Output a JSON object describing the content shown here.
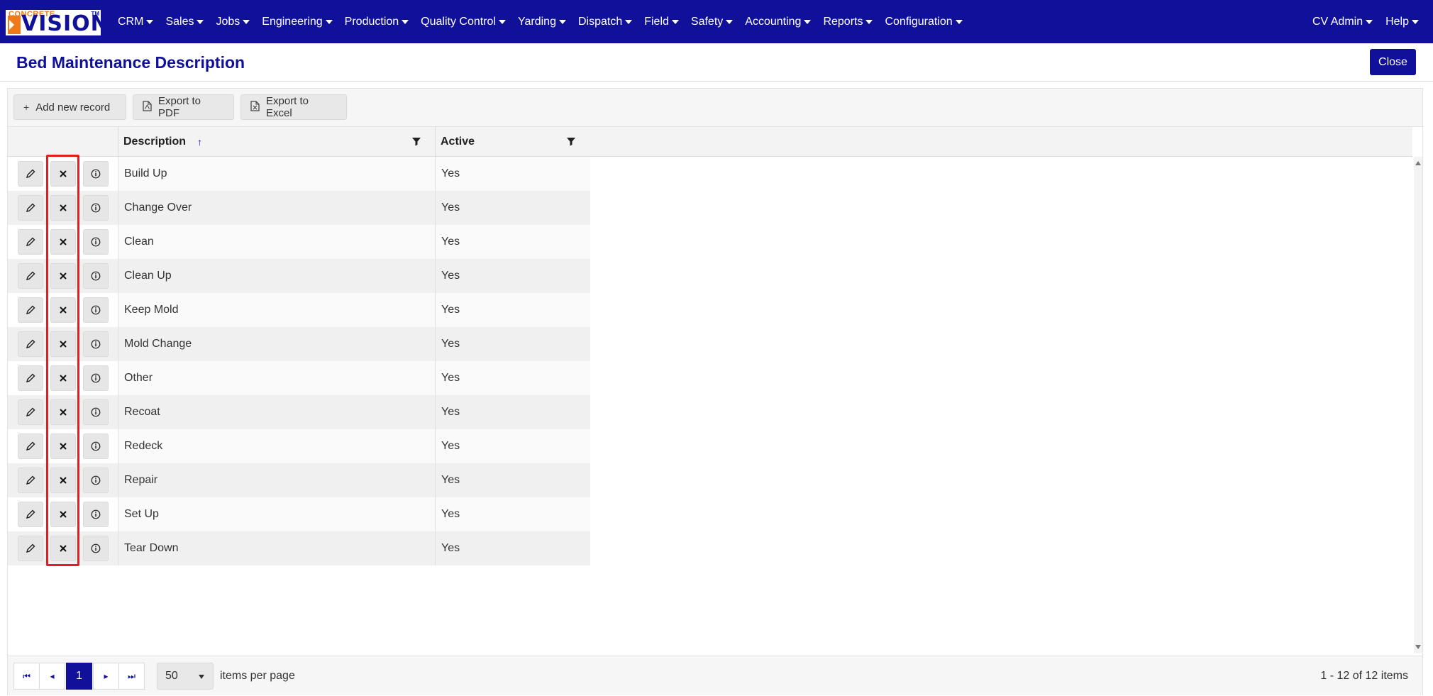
{
  "app": {
    "logo": {
      "top_text": "CONCRETE",
      "main_text": "VISION",
      "tm": "TM"
    },
    "nav": [
      {
        "label": "CRM",
        "name": "nav-crm"
      },
      {
        "label": "Sales",
        "name": "nav-sales"
      },
      {
        "label": "Jobs",
        "name": "nav-jobs"
      },
      {
        "label": "Engineering",
        "name": "nav-engineering"
      },
      {
        "label": "Production",
        "name": "nav-production"
      },
      {
        "label": "Quality Control",
        "name": "nav-quality-control"
      },
      {
        "label": "Yarding",
        "name": "nav-yarding"
      },
      {
        "label": "Dispatch",
        "name": "nav-dispatch"
      },
      {
        "label": "Field",
        "name": "nav-field"
      },
      {
        "label": "Safety",
        "name": "nav-safety"
      },
      {
        "label": "Accounting",
        "name": "nav-accounting"
      },
      {
        "label": "Reports",
        "name": "nav-reports"
      },
      {
        "label": "Configuration",
        "name": "nav-configuration"
      }
    ],
    "user_menu": "CV Admin",
    "help_menu": "Help",
    "colors": {
      "brand": "#10109a",
      "accent": "#f07a1a",
      "highlight": "#e02020"
    }
  },
  "page": {
    "title": "Bed Maintenance Description",
    "close_label": "Close"
  },
  "toolbar": {
    "add_label": "Add new record",
    "pdf_label": "Export to PDF",
    "excel_label": "Export to Excel"
  },
  "grid": {
    "columns": [
      {
        "label": "Description",
        "sorted": "ascending"
      },
      {
        "label": "Active"
      }
    ],
    "rows": [
      {
        "description": "Build Up",
        "active": "Yes"
      },
      {
        "description": "Change Over",
        "active": "Yes"
      },
      {
        "description": "Clean",
        "active": "Yes"
      },
      {
        "description": "Clean Up",
        "active": "Yes"
      },
      {
        "description": "Keep Mold",
        "active": "Yes"
      },
      {
        "description": "Mold Change",
        "active": "Yes"
      },
      {
        "description": "Other",
        "active": "Yes"
      },
      {
        "description": "Recoat",
        "active": "Yes"
      },
      {
        "description": "Redeck",
        "active": "Yes"
      },
      {
        "description": "Repair",
        "active": "Yes"
      },
      {
        "description": "Set Up",
        "active": "Yes"
      },
      {
        "description": "Tear Down",
        "active": "Yes"
      }
    ],
    "row_icons": [
      "pencil-icon",
      "close-icon",
      "info-icon"
    ]
  },
  "pager": {
    "current_page": "1",
    "page_size": "50",
    "page_size_label": "items per page",
    "info": "1 - 12 of 12 items"
  }
}
